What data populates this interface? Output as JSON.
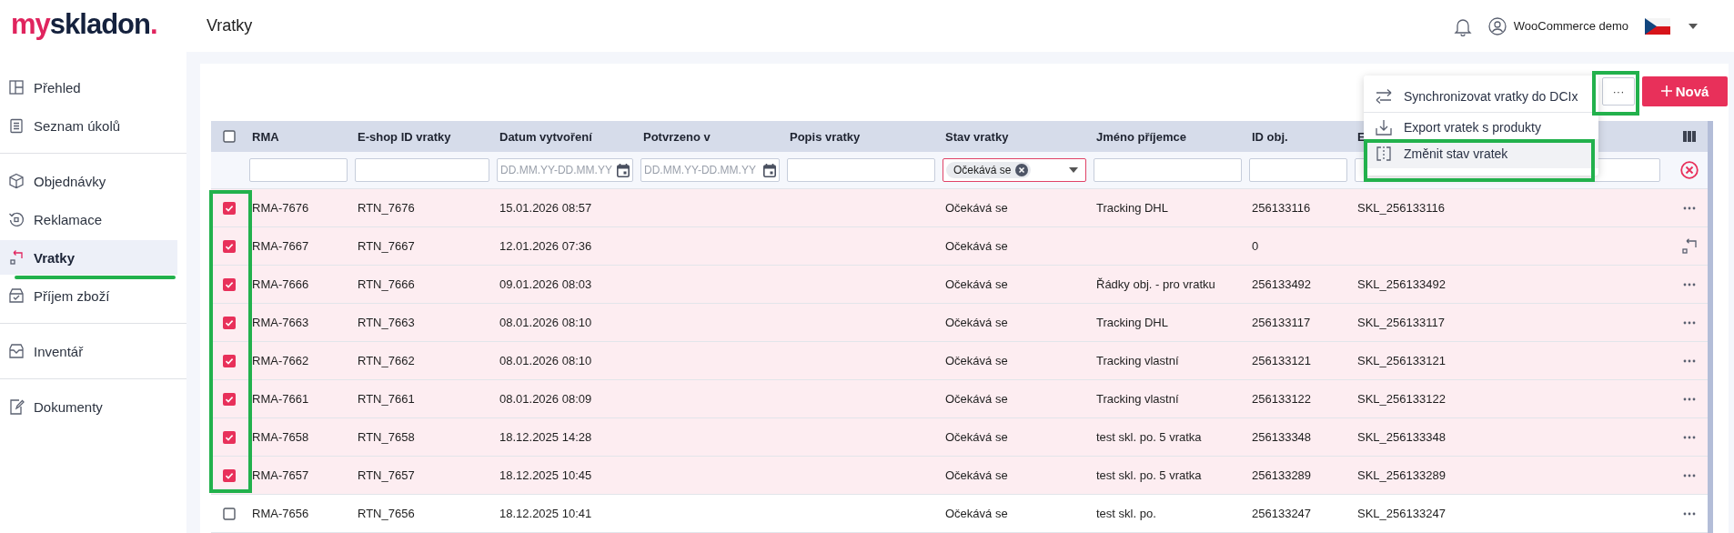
{
  "logo": {
    "part_1": "my",
    "part_2": "skladon",
    "dot": "."
  },
  "page_title": "Vratky",
  "header": {
    "user": "WooCommerce demo"
  },
  "sidebar": {
    "groups": [
      {
        "items": [
          {
            "label": "Přehled",
            "selected": false
          },
          {
            "label": "Seznam úkolů",
            "selected": false
          }
        ]
      },
      {
        "items": [
          {
            "label": "Objednávky",
            "selected": false
          },
          {
            "label": "Reklamace",
            "selected": false
          },
          {
            "label": "Vratky",
            "selected": true
          },
          {
            "label": "Příjem zboží",
            "selected": false
          }
        ]
      },
      {
        "items": [
          {
            "label": "Inventář",
            "selected": false
          }
        ]
      },
      {
        "items": [
          {
            "label": "Dokumenty",
            "selected": false
          }
        ]
      }
    ]
  },
  "toolbar": {
    "more": "···",
    "new": "Nová"
  },
  "menu": {
    "items": [
      {
        "label": "Synchronizovat vratky do DCIx",
        "selected": false
      },
      {
        "label": "Export vratek s produkty",
        "selected": false
      },
      {
        "label": "Změnit stav vratek",
        "selected": true
      }
    ]
  },
  "table": {
    "all_checked": false,
    "columns": [
      "RMA",
      "E-shop ID vratky",
      "Datum vytvoření",
      "Potvrzeno v",
      "Popis vratky",
      "Stav vratky",
      "Jméno příjemce",
      "ID obj.",
      "E"
    ],
    "filters": [
      {
        "kind": "text"
      },
      {
        "kind": "text"
      },
      {
        "kind": "date",
        "placeholder": "DD.MM.YY-DD.MM.YY"
      },
      {
        "kind": "date",
        "placeholder": "DD.MM.YY-DD.MM.YY"
      },
      {
        "kind": "text"
      },
      {
        "kind": "select",
        "chip": "Očekává se"
      },
      {
        "kind": "text"
      },
      {
        "kind": "text"
      },
      {
        "kind": "text"
      }
    ],
    "rows": [
      {
        "checked": true,
        "rma": "RMA-7676",
        "eshop_id": "RTN_7676",
        "created": "15.01.2026 08:57",
        "status": "Očekává se",
        "recipient": "Tracking DHL",
        "order_id": "256133116",
        "sku": "SKL_256133116",
        "kind": "more"
      },
      {
        "checked": true,
        "rma": "RMA-7667",
        "eshop_id": "RTN_7667",
        "created": "12.01.2026 07:36",
        "status": "Očekává se",
        "order_id": "0",
        "kind": "return"
      },
      {
        "checked": true,
        "rma": "RMA-7666",
        "eshop_id": "RTN_7666",
        "created": "09.01.2026 08:03",
        "status": "Očekává se",
        "recipient": "Řádky obj. - pro vratku",
        "order_id": "256133492",
        "sku": "SKL_256133492",
        "kind": "more"
      },
      {
        "checked": true,
        "rma": "RMA-7663",
        "eshop_id": "RTN_7663",
        "created": "08.01.2026 08:10",
        "status": "Očekává se",
        "recipient": "Tracking DHL",
        "order_id": "256133117",
        "sku": "SKL_256133117",
        "kind": "more"
      },
      {
        "checked": true,
        "rma": "RMA-7662",
        "eshop_id": "RTN_7662",
        "created": "08.01.2026 08:10",
        "status": "Očekává se",
        "recipient": "Tracking vlastní",
        "order_id": "256133121",
        "sku": "SKL_256133121",
        "kind": "more"
      },
      {
        "checked": true,
        "rma": "RMA-7661",
        "eshop_id": "RTN_7661",
        "created": "08.01.2026 08:09",
        "status": "Očekává se",
        "recipient": "Tracking vlastní",
        "order_id": "256133122",
        "sku": "SKL_256133122",
        "kind": "more"
      },
      {
        "checked": true,
        "rma": "RMA-7658",
        "eshop_id": "RTN_7658",
        "created": "18.12.2025 14:28",
        "status": "Očekává se",
        "recipient": "test skl. po. 5 vratka",
        "order_id": "256133348",
        "sku": "SKL_256133348",
        "kind": "more"
      },
      {
        "checked": true,
        "rma": "RMA-7657",
        "eshop_id": "RTN_7657",
        "created": "18.12.2025 10:45",
        "status": "Očekává se",
        "recipient": "test skl. po. 5 vratka",
        "order_id": "256133289",
        "sku": "SKL_256133289",
        "kind": "more"
      },
      {
        "checked": false,
        "rma": "RMA-7656",
        "eshop_id": "RTN_7656",
        "created": "18.12.2025 10:41",
        "status": "Očekává se",
        "recipient": "test skl. po.",
        "order_id": "256133247",
        "sku": "SKL_256133247",
        "kind": "more"
      }
    ]
  }
}
